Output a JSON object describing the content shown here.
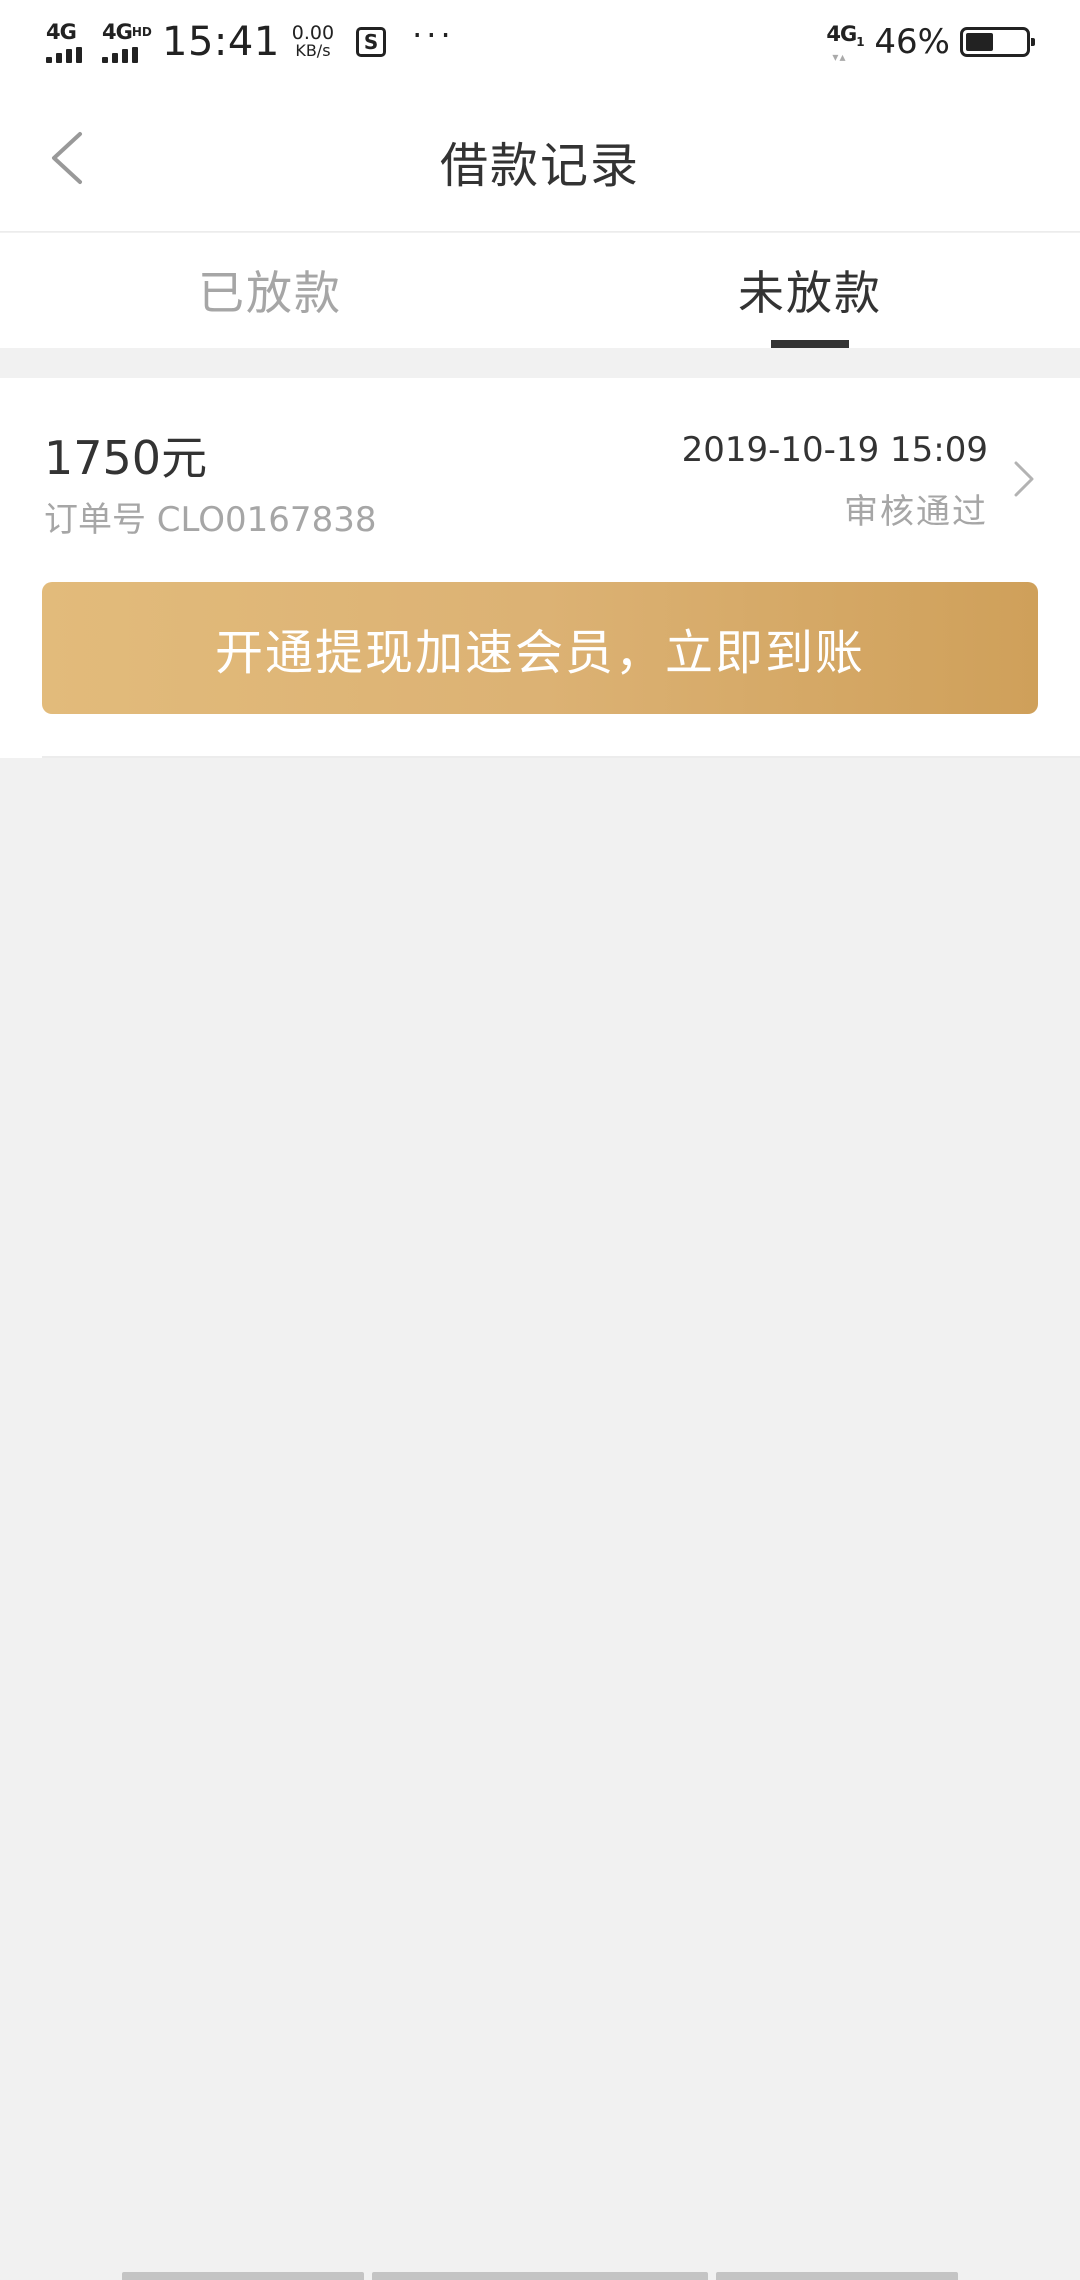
{
  "status_bar": {
    "network1": "4G",
    "network2": "4G",
    "network2_sup": "HD",
    "time": "15:41",
    "speed_value": "0.00",
    "speed_unit": "KB/s",
    "screenshot_icon": "S",
    "more": "···",
    "network3": "4G",
    "network3_sub": "1",
    "battery_percent": "46%",
    "battery_level": 0.46
  },
  "nav": {
    "title": "借款记录",
    "back_icon": "chevron-left-icon"
  },
  "tabs": [
    {
      "label": "已放款",
      "active": false
    },
    {
      "label": "未放款",
      "active": true
    }
  ],
  "record": {
    "amount": "1750元",
    "order": "订单号 CLO0167838",
    "date": "2019-10-19 15:09",
    "status": "审核通过",
    "cta_label": "开通提现加速会员，立即到账"
  },
  "colors": {
    "accent_gradient_start": "#e2bb7b",
    "accent_gradient_end": "#cfa05a",
    "text_primary": "#333333",
    "text_secondary": "#a6a6a6",
    "background": "#f1f1f1"
  }
}
